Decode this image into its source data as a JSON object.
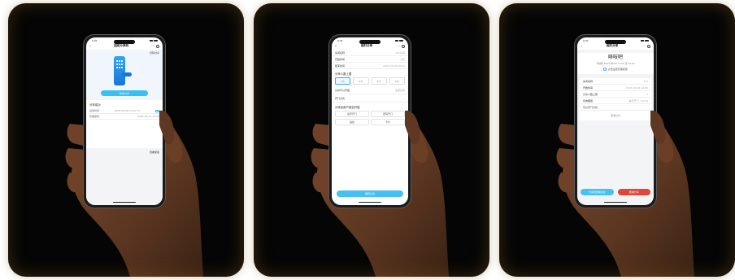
{
  "phones": [
    {
      "title": "固定分享码",
      "top_right_link": "扫码分享",
      "primary_button": "暂停分享",
      "section_title": "分享成功",
      "rows": [
        {
          "label": "设置时间",
          "value": "2024-06-06 14:07:37"
        },
        {
          "label": "管理密码",
          "value": "2024-06-13 12:00"
        }
      ],
      "bottom_link": "查看使用"
    },
    {
      "title": "临时分享",
      "rows": [
        {
          "label": "房间名称",
          "value": "101房间"
        },
        {
          "label": "开始时间",
          "value": "今天"
        },
        {
          "label": "结束时间",
          "value": "2024-06-06 20:00"
        }
      ],
      "section_title": "分享人数上限",
      "chips": [
        "1人",
        "2人",
        "3人",
        "5人"
      ],
      "rows2": [
        {
          "label": "分享可以开锁",
          "value": "全部房间"
        },
        {
          "label": "开门方式",
          "value": ""
        }
      ],
      "section2_title": "分享后用户能否开锁",
      "grid": [
        "蓝牙开门",
        "密码开门",
        "指纹",
        "卡片"
      ],
      "submit_label": "确定分享"
    },
    {
      "title": "临时分享",
      "big_title": "哆吱吧",
      "subtitle": "有效期 2024-06-06 14:00 至 20:00",
      "link": "点击设置管理权限",
      "rows": [
        {
          "label": "房间名称",
          "value": "101"
        },
        {
          "label": "开始时间",
          "value": "2024-06-06 14:00"
        },
        {
          "label": "分享人数上限",
          "value": "1"
        },
        {
          "label": "有效期限",
          "value": "每天开门 · 20:00"
        },
        {
          "label": "可以开门方式",
          "value": ""
        }
      ],
      "center_link": "取消分享",
      "btn_left": "分享给微信好友",
      "btn_right": "删除分享"
    }
  ],
  "colors": {
    "accent": "#38bff3",
    "danger": "#e2463a",
    "panel": "#050505"
  }
}
